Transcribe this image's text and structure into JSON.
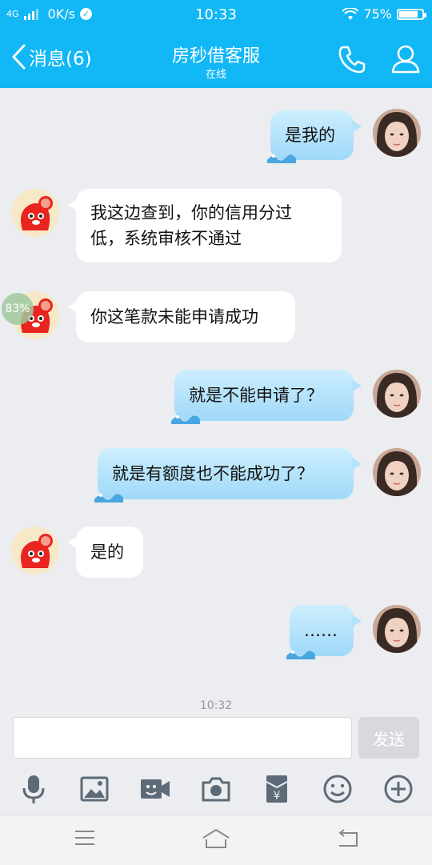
{
  "status_bar": {
    "network": "4G",
    "speed": "0K/s",
    "time": "10:33",
    "battery": "75%"
  },
  "nav": {
    "back_label": "消息(6)",
    "title": "房秒借客服",
    "subtitle": "在线"
  },
  "messages": [
    {
      "from": "me",
      "text": "是我的"
    },
    {
      "from": "bot",
      "lines": [
        "我这边查到，你的信用分过",
        "低，系统审核不通过"
      ]
    },
    {
      "from": "bot",
      "text": "你这笔款未能申请成功"
    },
    {
      "from": "me",
      "text": "就是不能申请了？"
    },
    {
      "from": "me",
      "text": "就是有额度也不能成功了？"
    },
    {
      "from": "bot",
      "text": "是的"
    },
    {
      "from": "me",
      "text": "……"
    }
  ],
  "upload_progress": "83%",
  "timestamp": "10:32",
  "composer": {
    "input_value": "",
    "send_label": "发送"
  },
  "toolbar_icons": [
    "microphone-icon",
    "image-icon",
    "video-icon",
    "camera-icon",
    "red-packet-icon",
    "emoji-icon",
    "plus-icon"
  ],
  "colors": {
    "accent": "#12b7f5",
    "my_bubble": "#b5e3fb",
    "bot_avatar": "#e8251f"
  }
}
